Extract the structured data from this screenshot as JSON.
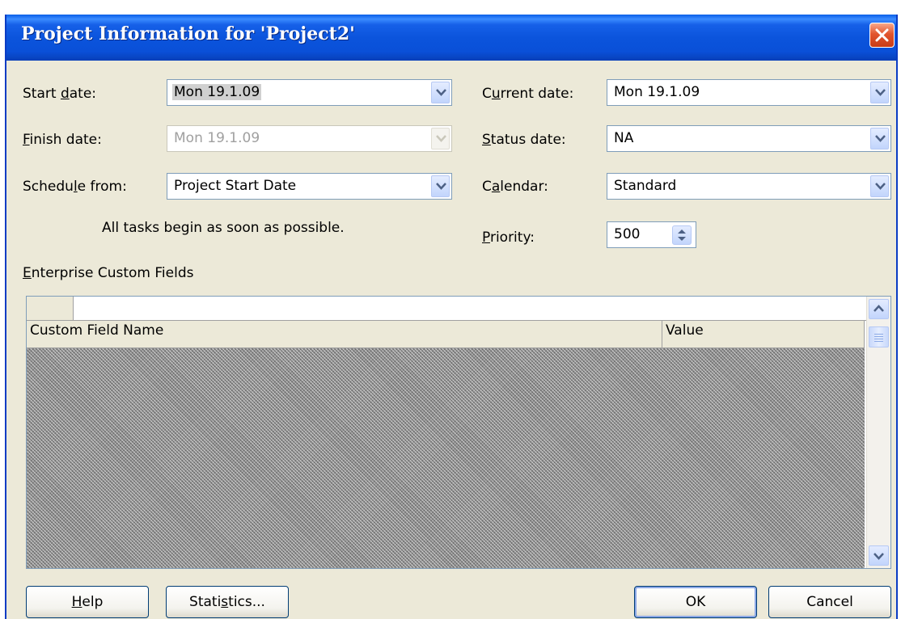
{
  "window": {
    "title": "Project Information for 'Project2'"
  },
  "left": {
    "start_date": {
      "label_pre": "Start ",
      "label_key": "d",
      "label_post": "ate:",
      "value": "Mon 19.1.09"
    },
    "finish_date": {
      "label_pre": "",
      "label_key": "F",
      "label_post": "inish date:",
      "value": "Mon 19.1.09"
    },
    "schedule_from": {
      "label_pre": "Schedu",
      "label_key": "l",
      "label_post": "e from:",
      "value": "Project Start Date"
    },
    "schedule_note": "All tasks begin as soon as possible."
  },
  "right": {
    "current_date": {
      "label_pre": "C",
      "label_key": "u",
      "label_post": "rrent date:",
      "value": "Mon 19.1.09"
    },
    "status_date": {
      "label_pre": "",
      "label_key": "S",
      "label_post": "tatus date:",
      "value": "NA"
    },
    "calendar": {
      "label_pre": "C",
      "label_key": "a",
      "label_post": "lendar:",
      "value": "Standard"
    },
    "priority": {
      "label_pre": "",
      "label_key": "P",
      "label_post": "riority:",
      "value": "500"
    }
  },
  "enterprise": {
    "label_key": "E",
    "label_post": "nterprise Custom Fields",
    "columns": [
      "Custom Field Name",
      "Value"
    ]
  },
  "buttons": {
    "help_key": "H",
    "help_post": "elp",
    "statistics_pre": "Stati",
    "statistics_key": "s",
    "statistics_post": "tics...",
    "ok": "OK",
    "cancel": "Cancel"
  },
  "icons": {
    "dropdown": "chevron-down-icon",
    "spinner": "up-down-spinner-icon",
    "close": "close-icon",
    "scroll_up": "chevron-up-icon",
    "scroll_down": "chevron-down-icon"
  },
  "colors": {
    "titlebar": "#0a54dc",
    "dialog_bg": "#ece9d8",
    "close": "#e2552d"
  }
}
